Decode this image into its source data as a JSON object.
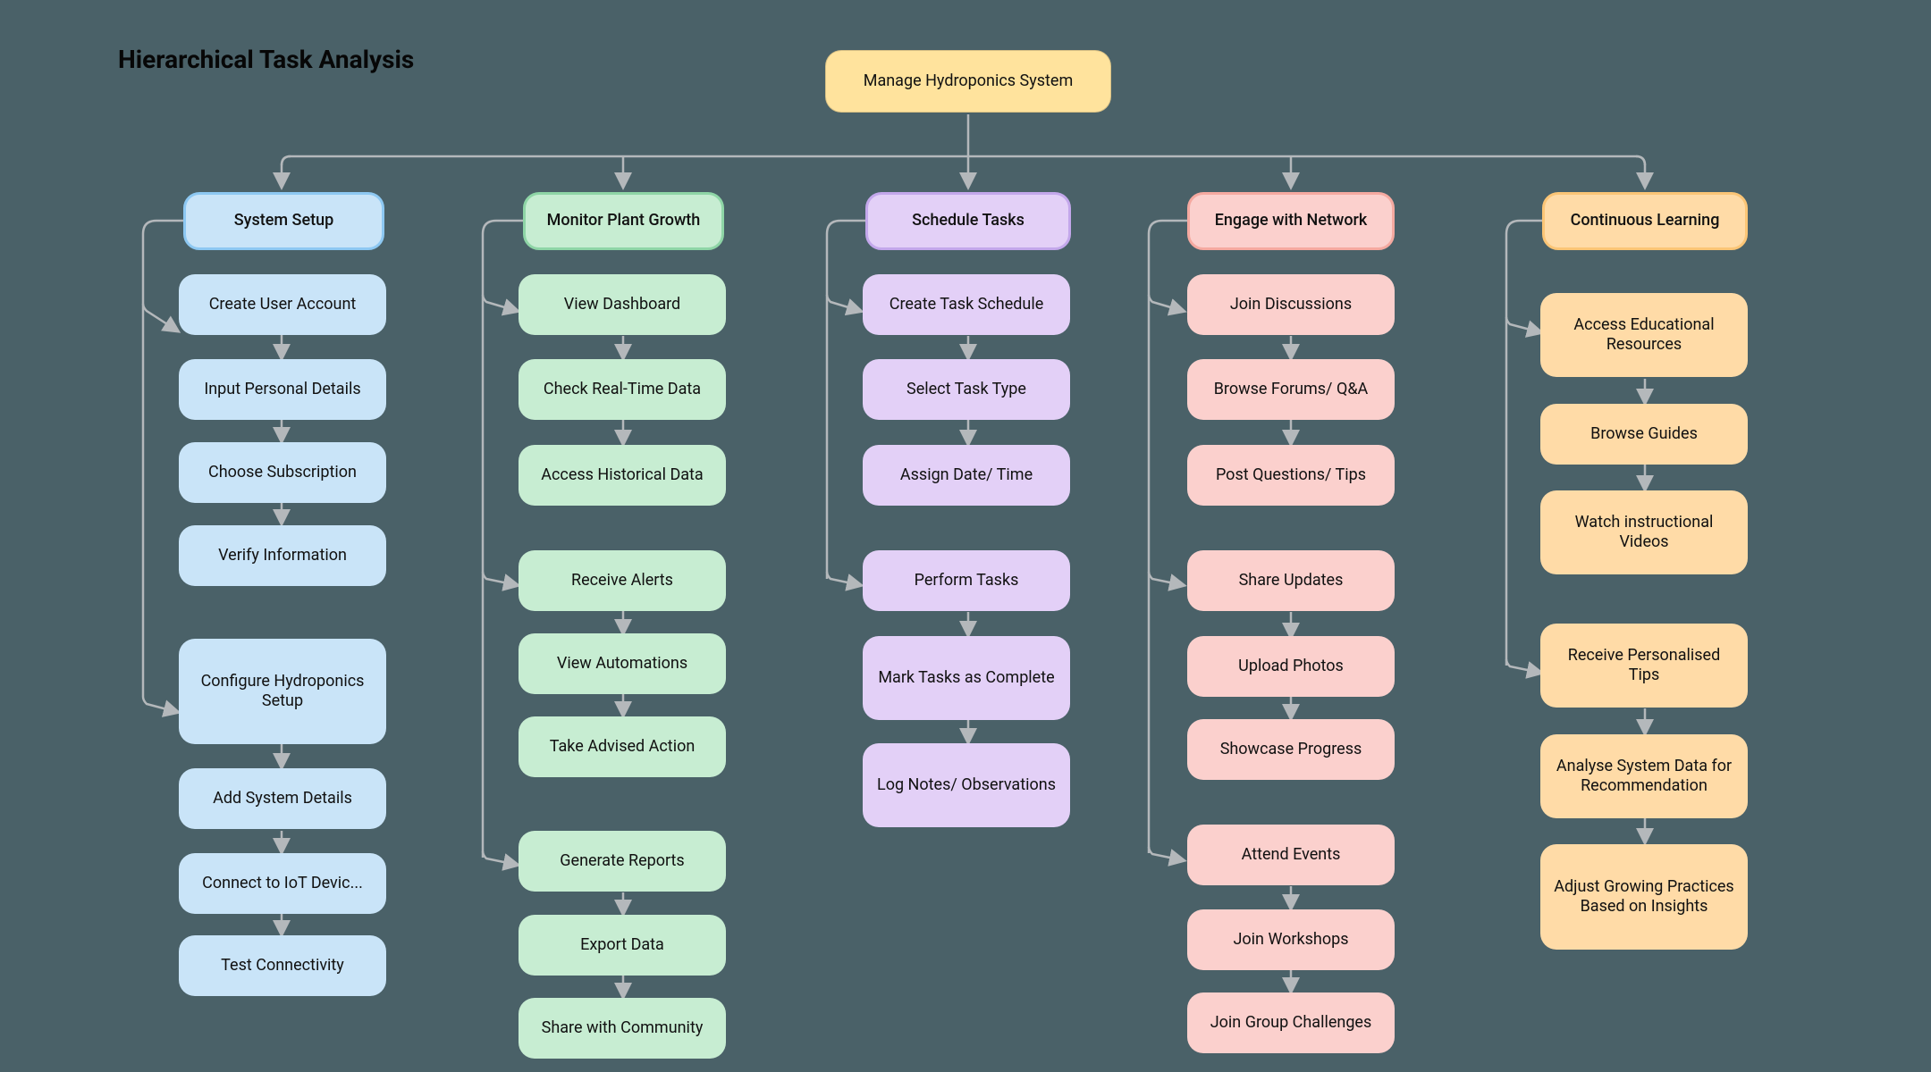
{
  "title": "Hierarchical Task Analysis",
  "root": "Manage Hydroponics System",
  "cats": {
    "blue": "System Setup",
    "green": "Monitor Plant Growth",
    "purple": "Schedule Tasks",
    "pink": "Engage with Network",
    "orange": "Continuous Learning"
  },
  "blue": {
    "a1": "Create User Account",
    "a2": "Input Personal Details",
    "a3": "Choose Subscription",
    "a4": "Verify Information",
    "b1": "Configure Hydroponics Setup",
    "b2": "Add System Details",
    "b3": "Connect to IoT Devic...",
    "b4": "Test Connectivity"
  },
  "green": {
    "a1": "View Dashboard",
    "a2": "Check Real-Time Data",
    "a3": "Access Historical Data",
    "b1": "Receive Alerts",
    "b2": "View Automations",
    "b3": "Take Advised Action",
    "c1": "Generate Reports",
    "c2": "Export Data",
    "c3": "Share with Community"
  },
  "purple": {
    "a1": "Create Task Schedule",
    "a2": "Select Task Type",
    "a3": "Assign Date/ Time",
    "b1": "Perform Tasks",
    "b2": "Mark Tasks as Complete",
    "b3": "Log Notes/ Observations"
  },
  "pink": {
    "a1": "Join Discussions",
    "a2": "Browse Forums/ Q&A",
    "a3": "Post Questions/ Tips",
    "b1": "Share Updates",
    "b2": "Upload Photos",
    "b3": "Showcase Progress",
    "c1": "Attend Events",
    "c2": "Join Workshops",
    "c3": "Join Group Challenges"
  },
  "orange": {
    "a1": "Access Educational Resources",
    "a2": "Browse Guides",
    "a3": "Watch instructional Videos",
    "b1": "Receive Personalised Tips",
    "b2": "Analyse System Data for Recommendation",
    "b3": "Adjust Growing Practices Based on Insights"
  }
}
